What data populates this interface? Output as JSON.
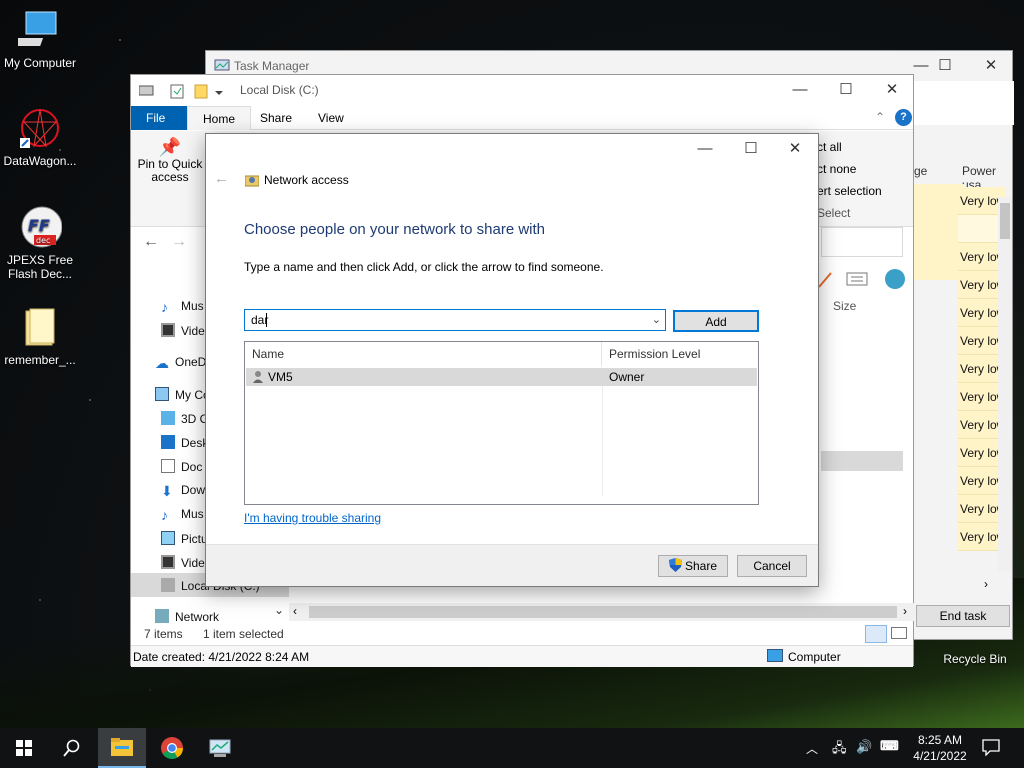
{
  "desktop": {
    "icons": [
      {
        "label": "My Computer"
      },
      {
        "label": "DataWagon..."
      },
      {
        "label": "JPEXS Free Flash Dec..."
      },
      {
        "label": "remember_..."
      },
      {
        "label": "Recycle Bin"
      }
    ]
  },
  "task_manager": {
    "title": "Task Manager",
    "col_fragment_1": "ge",
    "col_power": "Power usa",
    "rows": [
      "Very low",
      "Very low",
      "Very low",
      "Very low",
      "Very low",
      "Very low",
      "Very low",
      "Very low",
      "Very low",
      "Very low",
      "Very low",
      "Very low"
    ],
    "end_task": "End task"
  },
  "explorer": {
    "title": "Local Disk (C:)",
    "tabs": {
      "file": "File",
      "home": "Home",
      "share": "Share",
      "view": "View"
    },
    "pin_label": "Pin to Quick access",
    "select_all": "ct all",
    "select_none": "ct none",
    "invert_selection": "ert selection",
    "select_group": "Select",
    "size_col": "Size",
    "nav": [
      "Mus",
      "Vide",
      "OneD",
      "My Co",
      "3D O",
      "Desk",
      "Doc",
      "Dow",
      "Mus",
      "Pictu",
      "Vide",
      "Local Disk (C:)",
      "Network"
    ],
    "status_items": "7 items",
    "status_selected": "1 item selected",
    "details_date": "Date created: 4/21/2022 8:24 AM",
    "details_computer": "Computer"
  },
  "dialog": {
    "header": "Network access",
    "heading": "Choose people on your network to share with",
    "instruction": "Type a name and then click Add, or click the arrow to find someone.",
    "input_value": "dar",
    "add_label": "Add",
    "col_name": "Name",
    "col_permission": "Permission Level",
    "rows": [
      {
        "name": "VM5",
        "permission": "Owner"
      }
    ],
    "trouble_link": "I'm having trouble sharing",
    "share_label": "Share",
    "cancel_label": "Cancel"
  },
  "taskbar": {
    "time": "8:25 AM",
    "date": "4/21/2022"
  },
  "colors": {
    "accent": "#0063b1",
    "heading": "#1e3b73",
    "link": "#0066cc"
  }
}
